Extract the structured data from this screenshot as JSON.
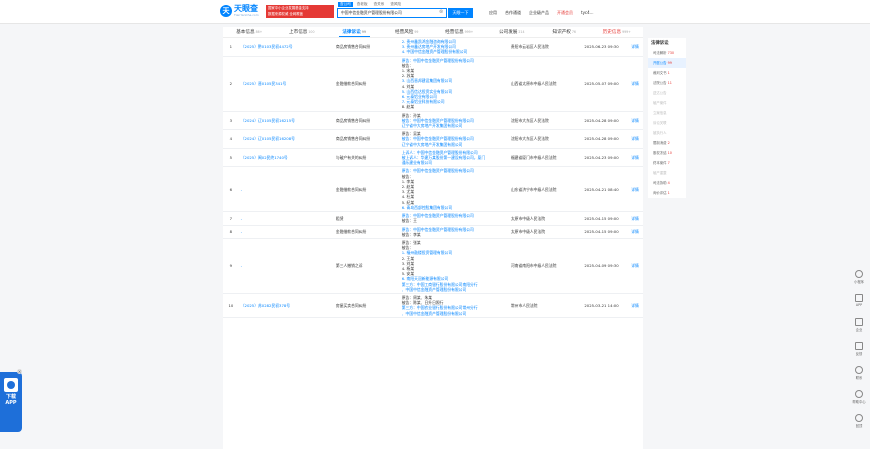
{
  "header": {
    "logo_mark": "天",
    "logo_text": "天眼查",
    "logo_sub": "TianYanCha.com",
    "ad_line1": "国家中小企业发展基金支持",
    "ad_line2": "数据来源权威 全网覆盖",
    "search_tabs": [
      "查公司",
      "查老板",
      "查关系",
      "查风险"
    ],
    "search_value": "中国中信金融资产管理股份有限公司",
    "search_button": "天眼一下",
    "nav": [
      "应用",
      "合作通道",
      "企业级产品",
      "开通会员",
      "tyc4..."
    ]
  },
  "tabs": [
    {
      "label": "基本信息",
      "count": "86+"
    },
    {
      "label": "上市信息",
      "count": "100"
    },
    {
      "label": "法律诉讼",
      "count": "99"
    },
    {
      "label": "经营风险",
      "count": "99"
    },
    {
      "label": "经营信息",
      "count": "999+"
    },
    {
      "label": "公司发展",
      "count": "214"
    },
    {
      "label": "知识产权",
      "count": "76"
    },
    {
      "label": "历史信息",
      "count": "999+"
    }
  ],
  "rows": [
    {
      "idx": "1",
      "case": "（2025）黔0103民初4472号",
      "cause": "商品房销售合同纠纷",
      "parties": [
        "2. 贵州鑫凯鸿金融咨询有限公司",
        "3. 贵州鑫达房地产开发有限公司",
        "4. 中国中信金融资产管理股份有限公司"
      ],
      "court": "贵阳市云岩区人民法院",
      "date": "2025-06-23 09:30",
      "op": "详情"
    },
    {
      "idx": "2",
      "case": "（2025）晋0105民341号",
      "cause": "金融借款合同纠纷",
      "parties": [
        "原告：中国中信金融资产管理股份有限公司",
        "被告：",
        "1. 宋某",
        "2. 苏某",
        "3. 山西晋邦建设集团有限公司",
        "4. 刘某",
        "5. 山西信达投资实业有限公司",
        "6. 元泰铝业有限公司",
        "7. 元泰铝业科技有限公司",
        "8. 赵某"
      ],
      "court": "山西省太原市中级人民法院",
      "date": "2025-05-07 09:00",
      "op": "详情"
    },
    {
      "idx": "3",
      "case": "（2024）辽0105民初16215号",
      "cause": "商品房销售合同纠纷",
      "parties": [
        "原告：孙某",
        "被告：中国中信金融资产管理股份有限公司",
        "辽宁省中大房地产开发集团有限公司"
      ],
      "court": "沈阳市大东区人民法院",
      "date": "2025-04-28 09:00",
      "op": "详情"
    },
    {
      "idx": "4",
      "case": "（2024）辽0105民初16208号",
      "cause": "商品房销售合同纠纷",
      "parties": [
        "原告：吴某",
        "被告：中国中信金融资产管理股份有限公司",
        "辽宁省中大房地产开发集团有限公司"
      ],
      "court": "沈阳市大东区人民法院",
      "date": "2025-04-28 09:00",
      "op": "详情"
    },
    {
      "idx": "5",
      "case": "（2025）闽02民终1740号",
      "cause": "与破产有关的纠纷",
      "parties": [
        "上诉人：中国中信金融资产管理股份有限公司",
        "被上诉人：华建万某股份第一建设有限公司，厦门",
        "通乐建业有限公司"
      ],
      "court": "福建省厦门市中级人民法院",
      "date": "2025-04-23 09:00",
      "op": "详情"
    },
    {
      "idx": "6",
      "case": "-",
      "cause": "金融借款合同纠纷",
      "parties": [
        "原告：中国中信金融资产管理股份有限公司",
        "被告：",
        "1. 李某",
        "2. 赵某",
        "3. 尤某",
        "4. 杜某",
        "5. 纪某",
        "6. 青岛西部控股集团有限公司"
      ],
      "court": "山东省济宁市中级人民法院",
      "date": "2025-04-21 08:40",
      "op": "详情"
    },
    {
      "idx": "7",
      "case": "-",
      "cause": "租赁",
      "parties": [
        "原告：中国中信金融资产管理股份有限公司",
        "被告：王"
      ],
      "court": "太原市中级人民法院",
      "date": "2025-04-15 09:00",
      "op": "详情"
    },
    {
      "idx": "8",
      "case": "-",
      "cause": "金融借款合同纠纷",
      "parties": [
        "原告：中国中信金融资产管理股份有限公司",
        "被告：李某"
      ],
      "court": "太原市中级人民法院",
      "date": "2025-04-15 09:00",
      "op": "详情"
    },
    {
      "idx": "9",
      "case": "-",
      "cause": "第三人撤销之诉",
      "parties": [
        "原告：张某",
        "被告：",
        "1. 福州鼓楼投资管理有限公司",
        "2. 王某",
        "3. 刘某",
        "4. 杨某",
        "5. 安某",
        "6. 南阳天冠新能源有限公司",
        "第三方：中国工商银行股份有限公司南阳分行",
        "、中国中信金融资产管理股份有限公司"
      ],
      "court": "河南省南阳市中级人民法院",
      "date": "2025-04-09 09:30",
      "op": "详情"
    },
    {
      "idx": "10",
      "case": "（2025）苏0282民初378号",
      "cause": "房屋买卖合同纠纷",
      "parties": [
        "原告：周某、朱某",
        "被告：陈某、日升日照行",
        "第三方：中国农业银行股份有限公司常州分行",
        "、中国中信金融资产管理股份有限公司"
      ],
      "court": "常州市人民法院",
      "date": "2025-03-21 14:00",
      "op": "详情"
    }
  ],
  "sidebar": {
    "title": "法律诉讼",
    "items": [
      {
        "label": "司法解析",
        "count": "730"
      },
      {
        "label": "开庭公告",
        "count": "99"
      },
      {
        "label": "裁判文书",
        "count": "1"
      },
      {
        "label": "法院公告",
        "count": "11"
      },
      {
        "label": "送达公告",
        "count": ""
      },
      {
        "label": "破产案件",
        "count": ""
      },
      {
        "label": "立案信息",
        "count": ""
      },
      {
        "label": "诉讼关联",
        "count": ""
      },
      {
        "label": "被执行人",
        "count": ""
      },
      {
        "label": "限制消费",
        "count": "2"
      },
      {
        "label": "股权冻结",
        "count": "10"
      },
      {
        "label": "终本案件",
        "count": "7"
      },
      {
        "label": "破产重整",
        "count": ""
      },
      {
        "label": "司法协助",
        "count": "4"
      },
      {
        "label": "询价评估",
        "count": "1"
      }
    ]
  },
  "tools": [
    "小程序",
    "APP",
    "企业",
    "反馈",
    "联系",
    "帮助中心",
    "回顶"
  ],
  "app_promo": {
    "line1": "下载",
    "line2": "APP"
  },
  "app_close": "×",
  "colors": {
    "accent": "#0084ff",
    "danger": "#e53935",
    "promo": "#1e6fd9"
  }
}
